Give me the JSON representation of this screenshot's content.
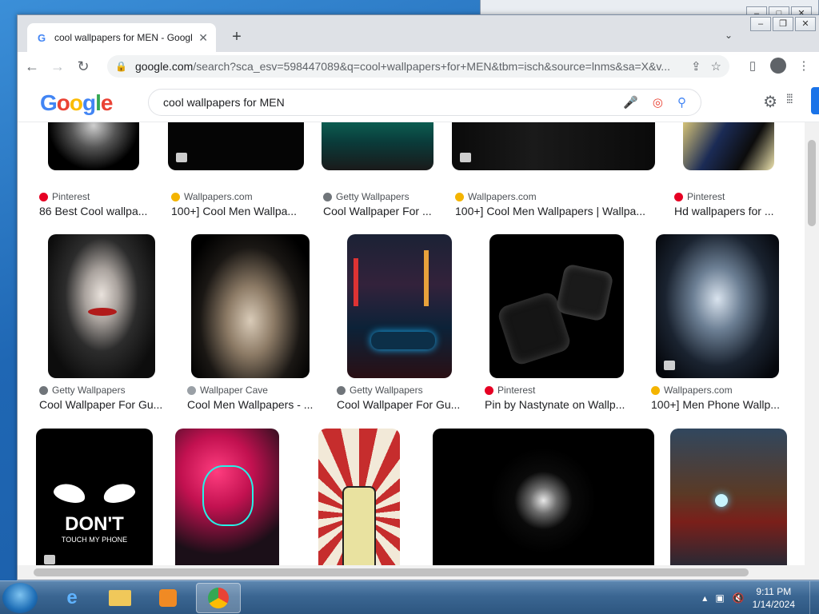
{
  "browser": {
    "tab_title": "cool wallpapers for MEN - Googl",
    "url_main": "google.com",
    "url_rest": "/search?sca_esv=598447089&q=cool+wallpapers+for+MEN&tbm=isch&source=lnms&sa=X&v..."
  },
  "google": {
    "logo": [
      "G",
      "o",
      "o",
      "g",
      "l",
      "e"
    ],
    "query": "cool wallpapers for MEN"
  },
  "results": [
    {
      "source": "Pinterest",
      "title": "86 Best Cool wallpa...",
      "fav": "#e60023"
    },
    {
      "source": "Wallpapers.com",
      "title": "100+] Cool Men Wallpa...",
      "fav": "#f4b400"
    },
    {
      "source": "Getty Wallpapers",
      "title": "Cool Wallpaper For ...",
      "fav": "#70757a"
    },
    {
      "source": "Wallpapers.com",
      "title": "100+] Cool Men Wallpapers | Wallpa...",
      "fav": "#f4b400"
    },
    {
      "source": "Pinterest",
      "title": "Hd wallpapers for ...",
      "fav": "#e60023"
    },
    {
      "source": "Getty Wallpapers",
      "title": "Cool Wallpaper For Gu...",
      "fav": "#70757a"
    },
    {
      "source": "Wallpaper Cave",
      "title": "Cool Men Wallpapers - ...",
      "fav": "#9aa0a6"
    },
    {
      "source": "Getty Wallpapers",
      "title": "Cool Wallpaper For Gu...",
      "fav": "#70757a"
    },
    {
      "source": "Pinterest",
      "title": "Pin by Nastynate on Wallp...",
      "fav": "#e60023"
    },
    {
      "source": "Wallpapers.com",
      "title": "100+] Men Phone Wallp...",
      "fav": "#f4b400"
    }
  ],
  "row3_images": [
    "dont-touch-my-phone",
    "neon-mask",
    "rock-hand",
    "abstract-face",
    "iron-man"
  ],
  "dont_text": "DON'T",
  "dont_sub": "TOUCH MY PHONE",
  "taskbar": {
    "time": "9:11 PM",
    "date": "1/14/2024"
  }
}
